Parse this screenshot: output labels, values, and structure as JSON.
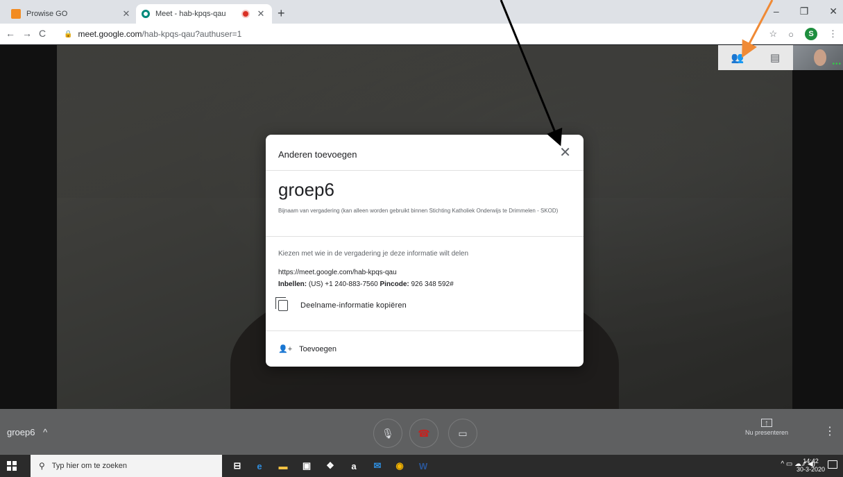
{
  "browser": {
    "tabs": [
      {
        "label": "Prowise GO",
        "icon": "prowise-icon",
        "close": "✕"
      },
      {
        "label": "Meet - hab-kpqs-qau",
        "icon": "meet-icon",
        "close": "✕",
        "active": true
      }
    ],
    "new_tab": "+",
    "window_controls": {
      "minimize": "–",
      "maximize": "❐",
      "close": "✕"
    },
    "nav": {
      "back": "←",
      "forward": "→",
      "reload": "C"
    },
    "url_host": "meet.google.com",
    "url_path": "/hab-kpqs-qau?authuser=1",
    "profile_initial": "S",
    "toolbar_icons": {
      "star": "☆",
      "extension": "○",
      "menu": "⋮"
    }
  },
  "meet": {
    "side_panel": {
      "people_icon": "👥",
      "chat_icon": "▤"
    },
    "self_view_dots": "•••",
    "dialog": {
      "title": "Anderen toevoegen",
      "close": "✕",
      "meeting_nickname": "groep6",
      "nickname_note": "Bijnaam van vergadering (kan alleen worden gebruikt binnen Stichting Katholiek Onderwijs te Drimmelen - SKOD)",
      "choose_text": "Kiezen met wie in de vergadering je deze informatie wilt delen",
      "link": "https://meet.google.com/hab-kpqs-qau",
      "dial_label": "Inbellen:",
      "dial_number": "(US) +1 240-883-7560",
      "pin_label": "Pincode:",
      "pin_value": "926 348 592#",
      "copy_label": "Deelname-informatie kopiëren",
      "add_icon": "+",
      "add_label": "Toevoegen"
    },
    "bottom_bar": {
      "meeting_name": "groep6",
      "caret": "^",
      "mic_icon": "🎙",
      "hangup_icon": "☎",
      "camera_icon": "▭",
      "present_icon": "↑",
      "present_label": "Nu presenteren",
      "more": "⋮"
    }
  },
  "taskbar": {
    "search_placeholder": "Typ hier om te zoeken",
    "search_icon": "⚲",
    "apps": [
      {
        "name": "task-view",
        "glyph": "⊟",
        "color": "#ffffff"
      },
      {
        "name": "edge",
        "glyph": "e",
        "color": "#2f8fe0"
      },
      {
        "name": "file-explorer",
        "glyph": "▬",
        "color": "#f5c343"
      },
      {
        "name": "store",
        "glyph": "▣",
        "color": "#ffffff"
      },
      {
        "name": "dropbox",
        "glyph": "❖",
        "color": "#ffffff"
      },
      {
        "name": "amazon",
        "glyph": "a",
        "color": "#ffffff"
      },
      {
        "name": "mail",
        "glyph": "✉",
        "color": "#2f8fe0"
      },
      {
        "name": "chrome",
        "glyph": "◉",
        "color": "#f4b400"
      },
      {
        "name": "word",
        "glyph": "W",
        "color": "#2b579a"
      }
    ],
    "tray_icons": "^  ▭  ☁  ⁄⁄  ◀)",
    "time": "14:42",
    "date": "30-3-2020"
  },
  "colors": {
    "annotation_black": "#000000",
    "annotation_orange": "#f08a35",
    "meet_bar": "#5f6061",
    "taskbar": "#2b2b2b"
  }
}
